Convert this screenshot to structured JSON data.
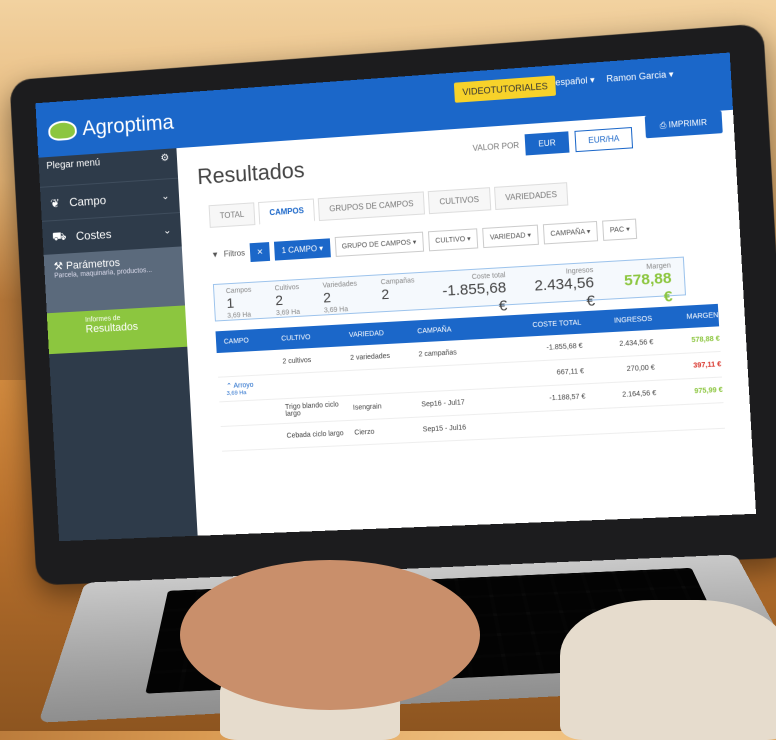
{
  "brand": {
    "name": "Agroptima",
    "accent": "#1b67c9",
    "green": "#8cc63f",
    "sidebar_bg": "#2e3b4a"
  },
  "header": {
    "tutorials_label": "VIDEOTUTORIALES",
    "language": "español",
    "user": "Ramon Garcia"
  },
  "sidebar": {
    "collapse_label": "Plegar menú",
    "items": [
      {
        "label": "Campo",
        "icon": "leaf-icon"
      },
      {
        "label": "Costes",
        "icon": "tractor-icon"
      }
    ],
    "params": {
      "label": "Parámetros",
      "sub": "Parcela, maquinaria, productos..."
    },
    "active": {
      "pre": "Informes de",
      "label": "Resultados"
    }
  },
  "page": {
    "title": "Resultados",
    "valor_label": "VALOR POR",
    "toggle": [
      "EUR",
      "EUR/HA"
    ],
    "print_label": "IMPRIMIR",
    "tabs": [
      "TOTAL",
      "CAMPOS",
      "GRUPOS DE CAMPOS",
      "CULTIVOS",
      "VARIEDADES"
    ],
    "filter_label": "Filtros",
    "chip_label": "1 CAMPO",
    "dropdowns": [
      "GRUPO DE CAMPOS",
      "CULTIVO",
      "VARIEDAD",
      "CAMPAÑA",
      "PAC"
    ],
    "totals": [
      {
        "label": "Coste total",
        "value": "-1.855,68 €"
      },
      {
        "label": "Ingresos",
        "value": "2.434,56 €"
      },
      {
        "label": "Margen",
        "value": "578,88 €"
      }
    ],
    "summary": [
      {
        "label": "Campos",
        "value": "1",
        "sub": "3,69 Ha"
      },
      {
        "label": "Cultivos",
        "value": "2",
        "sub": "3,69 Ha"
      },
      {
        "label": "Variedades",
        "value": "2",
        "sub": "3,69 Ha"
      },
      {
        "label": "Campañas",
        "value": "2",
        "sub": ""
      }
    ]
  },
  "table": {
    "headers": [
      "CAMPO",
      "CULTIVO",
      "VARIEDAD",
      "CAMPAÑA",
      "COSTE TOTAL",
      "INGRESOS",
      "MARGEN"
    ],
    "totals_row": [
      "",
      "2 cultivos",
      "2 variedades",
      "2 campañas",
      "-1.855,68 €",
      "2.434,56 €",
      "578,88 €"
    ],
    "farm_row": [
      "Arroyo",
      "",
      "",
      "",
      "667,11 €",
      "270,00 €",
      "397,11 €"
    ],
    "farm_sub": "3,69 Ha",
    "rows": [
      [
        "",
        "Trigo blando ciclo largo",
        "Isengrain",
        "Sep16 - Jul17",
        "-1.188,57 €",
        "2.164,56 €",
        "975,99 €"
      ],
      [
        "",
        "Cebada ciclo largo",
        "Cierzo",
        "Sep15 - Jul16",
        "",
        "",
        ""
      ]
    ]
  }
}
